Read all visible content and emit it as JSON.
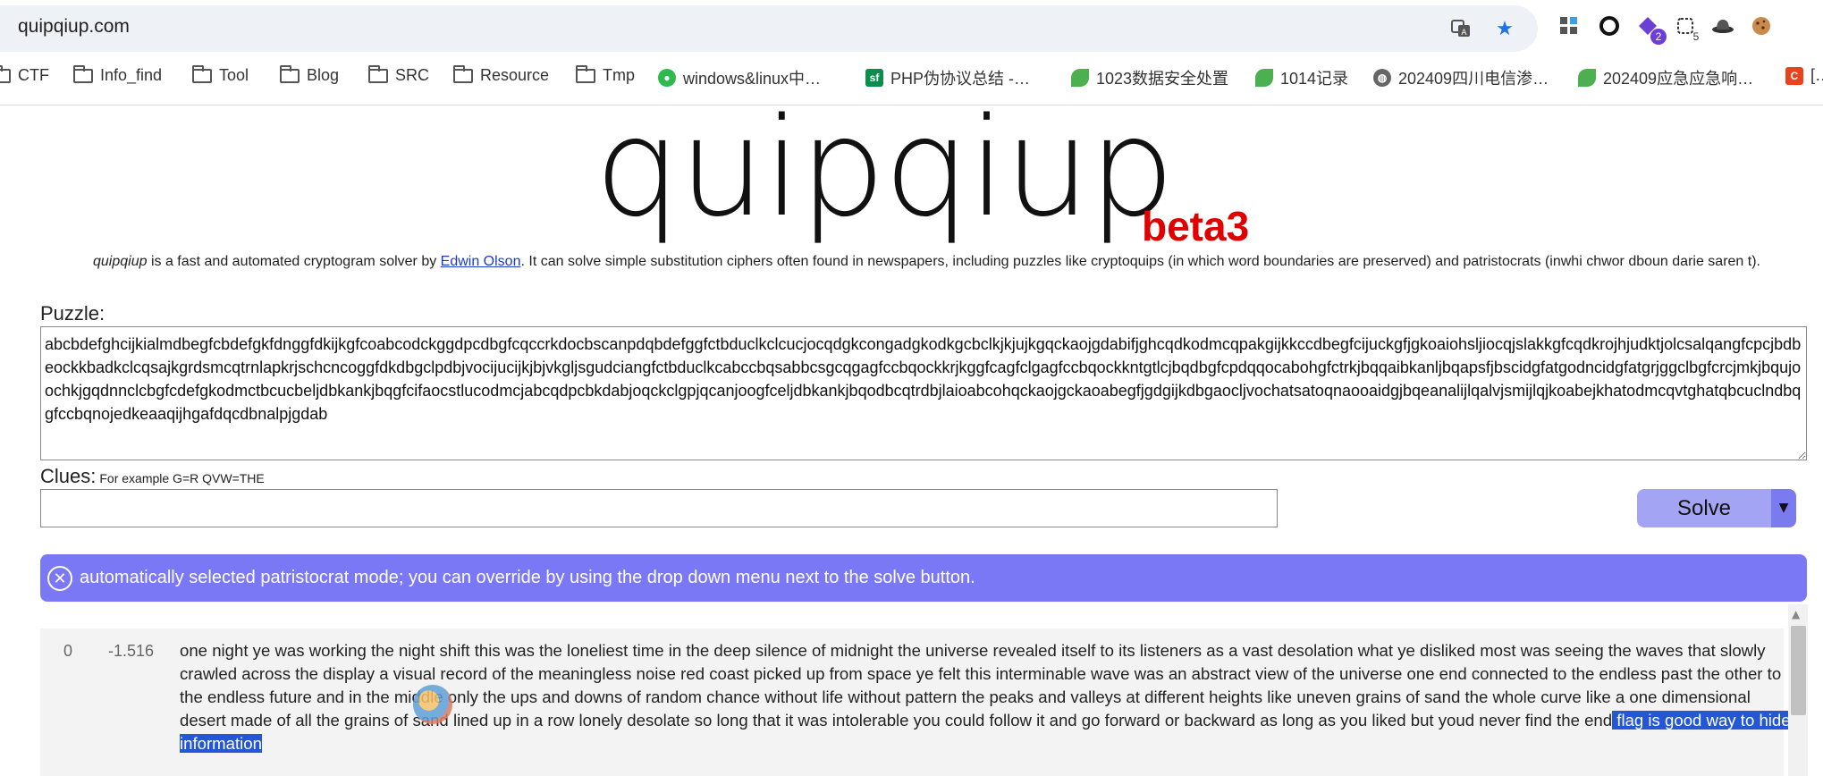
{
  "browser": {
    "url": "quipqiup.com",
    "bookmarks": [
      {
        "label": "CTF",
        "icon": "folder-icon"
      },
      {
        "label": "Info_find",
        "icon": "folder-icon"
      },
      {
        "label": "Tool",
        "icon": "folder-icon"
      },
      {
        "label": "Blog",
        "icon": "folder-icon"
      },
      {
        "label": "SRC",
        "icon": "folder-icon"
      },
      {
        "label": "Resource",
        "icon": "folder-icon"
      },
      {
        "label": "Tmp",
        "icon": "folder-icon"
      },
      {
        "label": "windows&linux中…",
        "icon": "wechat-icon"
      },
      {
        "label": "PHP伪协议总结 -…",
        "icon": "sf-icon"
      },
      {
        "label": "1023数据安全处置",
        "icon": "leaf-icon"
      },
      {
        "label": "1014记录",
        "icon": "leaf-icon"
      },
      {
        "label": "202409四川电信渗…",
        "icon": "globe-icon"
      },
      {
        "label": "202409应急应急响…",
        "icon": "leaf-icon"
      },
      {
        "label": "[…",
        "icon": "c-icon"
      }
    ],
    "extension_badges": {
      "ext3": "2",
      "ext4": "5"
    }
  },
  "page": {
    "logo": "quipqiup",
    "beta": "beta3",
    "desc_name": "quipqiup",
    "desc_text1": " is a fast and automated cryptogram solver by ",
    "desc_link": "Edwin Olson",
    "desc_text2": ". It can solve simple substitution ciphers often found in newspapers, including puzzles like cryptoquips (in which word boundaries are preserved) and patristocrats (inwhi chwor dboun darie saren t).",
    "puzzle_label": "Puzzle:",
    "puzzle_value": "abcbdefghcijkialmdbegfcbdefgkfdnggfdkijkgfcoabcodckggdpcdbgfcqccrkdocbscanpdqbdefggfctbduclkclcucjocqdgkcongadgkodkgcbclkjkjujkgqckaojgdabifjghcqdkodmcqpakgijkkccdbegfcijuckgfjgkoaiohsljiocqjslakkgfcqdkrojhjudktjolcsalqangfcpcjbdbeockkbadkclcqsajkgrdsmcqtrnlapkrjschcncoggfdkdbgclpdbjvocijucijkjbjvkgljsgudciangfctbduclkcabccbqsabbcsgcqgagfccbqockkrjkggfcagfclgagfccbqockkntgtlcjbqdbgfcpdqqocabohgfctrkjbqqaibkanljbqapsfjbscidgfatgodncidgfatgrjggclbgfcrcjmkjbqujoochkjgqdnnclcbgfcdefgkodmctbcucbeljdbkankjbqgfcifaocstlucodmcjabcqdpcbkdabjoqckclgpjqcanjoogfceljdbkankjbqodbcqtrdbjlaioabcohqckaojgckaoabegfjgdgijkdbgaocljvochatsatoqnaooaidgjbqeanalijlqalvjsmijlqjkoabejkhatodmcqvtghatqbcuclndbqgfccbqnojedkeaaqijhgafdqcdbnalpjgdab",
    "clues_label": "Clues:",
    "clues_hint": "For example G=R QVW=THE",
    "clues_value": "",
    "solve_label": "Solve",
    "solve_drop": "▼",
    "alert_text": "automatically selected patristocrat mode; you can override by using the drop down menu next to the solve button.",
    "result": {
      "rank": "0",
      "score": "-1.516",
      "text": "one night ye was working the night shift this was the loneliest time in the deep silence of midnight the universe revealed itself to its listeners as a vast desolation what ye disliked most was seeing the waves that slowly crawled across the display a visual record of the meaningless noise red coast picked up from space ye felt this interminable wave was an abstract view of the universe one end connected to the endless past the other to the endless future and in the middle only the ups and downs of random chance without life without pattern the peaks and valleys at different heights like uneven grains of sand the whole curve like a one dimensional desert made of all the grains of sand lined up in a row lonely desolate so long that it was intolerable you could follow it and go forward or backward as long as you liked but youd never find the end",
      "highlight": " flag is good way to hide information"
    }
  }
}
